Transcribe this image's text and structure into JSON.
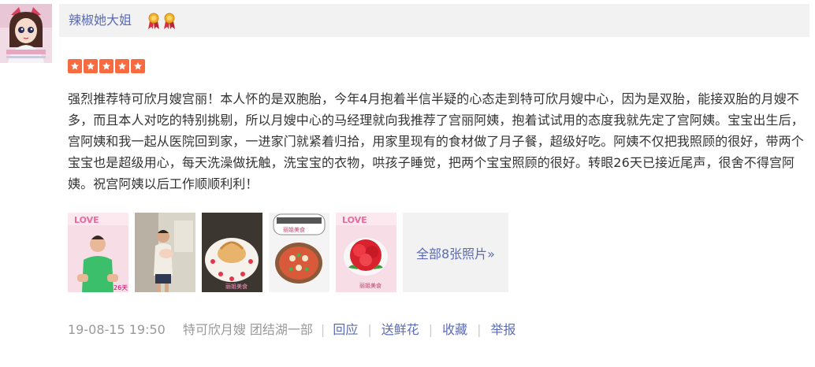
{
  "user": {
    "name": "辣椒她大姐",
    "badges": [
      "medal-icon",
      "medal-icon"
    ]
  },
  "rating": {
    "stars": 5,
    "max": 5,
    "color": "#f86b40"
  },
  "review": {
    "text": "强烈推荐特可欣月嫂宫丽！本人怀的是双胞胎，今年4月抱着半信半疑的心态走到特可欣月嫂中心，因为是双胎，能接双胎的月嫂不多，而且本人对吃的特别挑剔，所以月嫂中心的马经理就向我推荐了宫丽阿姨，抱着试试用的态度我就先定了宫阿姨。宝宝出生后，宫阿姨和我一起从医院回到家，一进家门就紧着归拾，用家里现有的食材做了月子餐，超级好吃。阿姨不仅把我照顾的很好，带两个宝宝也是超级用心，每天洗澡做抚触，洗宝宝的衣物，哄孩子睡觉，把两个宝宝照顾的很好。转眼26天已接近尾声，很舍不得宫阿姨。祝宫阿姨以后工作顺顺利利！"
  },
  "photos": {
    "thumbnail_captions": [
      "26天",
      "",
      "丽姐美食",
      "丽姐美食",
      "丽姐美食"
    ],
    "more_label": "全部8张照片»"
  },
  "footer": {
    "date": "19-08-15 19:50",
    "source": "特可欣月嫂 团结湖一部",
    "actions": {
      "reply": "回应",
      "flower": "送鲜花",
      "favorite": "收藏",
      "report": "举报"
    },
    "separator": "|"
  },
  "colors": {
    "link": "#5b6bb5",
    "name_bar": "#f2f2f2",
    "meta": "#999999",
    "star": "#f86b40"
  }
}
